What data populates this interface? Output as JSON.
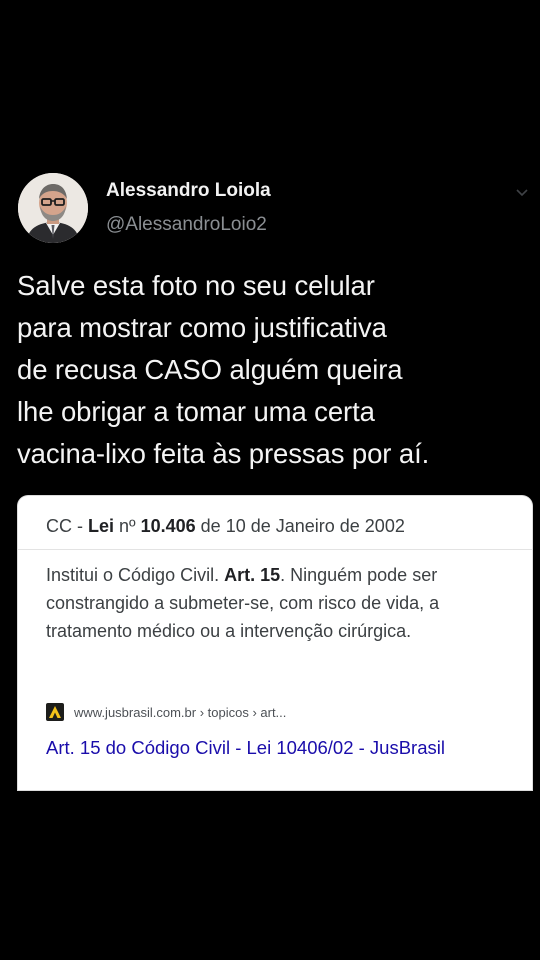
{
  "author": {
    "display_name": "Alessandro Loiola",
    "handle": "@AlessandroLoio2"
  },
  "tweet": {
    "text": "Salve esta foto no seu celular\npara mostrar como justificativa\nde recusa CASO alguém queira\nlhe obrigar a tomar uma certa\nvacina-lixo feita às pressas por aí."
  },
  "card": {
    "header_prefix": "CC - ",
    "header_lei": "Lei",
    "header_n": " nº ",
    "header_number": "10.406",
    "header_suffix": " de 10 de Janeiro de 2002",
    "body_part1": "Institui o Código Civil. ",
    "body_art": "Art. 15",
    "body_part2": ". Ninguém pode ser constrangido a submeter-se, com risco de vida, a tratamento médico ou a intervenção cirúrgica.",
    "source_url": "www.jusbrasil.com.br › topicos › art...",
    "result_title": "Art. 15 do Código Civil - Lei 10406/02 - JusBrasil"
  },
  "icons": {
    "more": "chevron-down-icon",
    "favicon": "jusbrasil-favicon-icon"
  },
  "colors": {
    "background": "#000000",
    "link": "#1a0dab",
    "handle": "#8b8f93"
  }
}
